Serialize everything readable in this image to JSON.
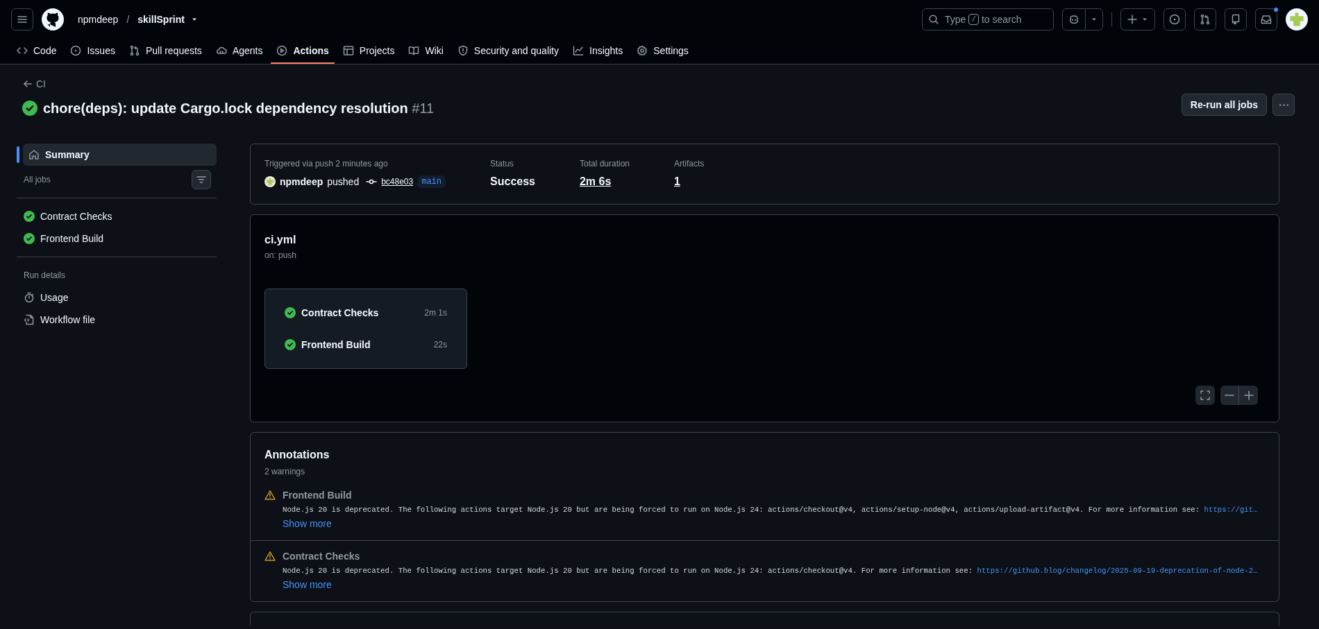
{
  "header": {
    "owner": "npmdeep",
    "separator": "/",
    "repo": "skillSprint",
    "search_placeholder_before": "Type",
    "search_key": "/",
    "search_placeholder_after": "to search",
    "notification_dot": true
  },
  "tabs": [
    {
      "label": "Code",
      "kind": "code",
      "selected": false
    },
    {
      "label": "Issues",
      "kind": "issue",
      "selected": false
    },
    {
      "label": "Pull requests",
      "kind": "pr",
      "selected": false
    },
    {
      "label": "Agents",
      "kind": "agent",
      "selected": false
    },
    {
      "label": "Actions",
      "kind": "play",
      "selected": true
    },
    {
      "label": "Projects",
      "kind": "table",
      "selected": false
    },
    {
      "label": "Wiki",
      "kind": "book",
      "selected": false
    },
    {
      "label": "Security and quality",
      "kind": "shield",
      "selected": false
    },
    {
      "label": "Insights",
      "kind": "graph",
      "selected": false
    },
    {
      "label": "Settings",
      "kind": "gear",
      "selected": false
    }
  ],
  "run": {
    "back_label": "CI",
    "kind": "success",
    "title": "chore(deps): update Cargo.lock dependency resolution",
    "number": "#11",
    "rerun_button": "Re-run all jobs"
  },
  "sidebar": {
    "summary": {
      "label": "Summary",
      "selected": true
    },
    "jobs_heading": "All jobs",
    "jobs": [
      {
        "label": "Contract Checks",
        "kind": "success",
        "selected": false
      },
      {
        "label": "Frontend Build",
        "kind": "success",
        "selected": false
      }
    ],
    "details_heading": "Run details",
    "details": [
      {
        "label": "Usage",
        "kind": "stopwatch"
      },
      {
        "label": "Workflow file",
        "kind": "file"
      }
    ]
  },
  "summary": {
    "trigger": "Triggered via push 2 minutes ago",
    "actor": "npmdeep",
    "action": "pushed",
    "commit": "bc48e03",
    "branch": "main",
    "stats": [
      {
        "label": "Status",
        "value": "Success",
        "link": false
      },
      {
        "label": "Total duration",
        "value": "2m 6s",
        "link": true
      },
      {
        "label": "Artifacts",
        "value": "1",
        "link": true
      }
    ]
  },
  "workflow": {
    "file": "ci.yml",
    "trigger": "on: push",
    "jobs": [
      {
        "name": "Contract Checks",
        "duration": "2m 1s",
        "kind": "success"
      },
      {
        "name": "Frontend Build",
        "duration": "22s",
        "kind": "success"
      }
    ]
  },
  "annotations": {
    "title": "Annotations",
    "count": "2 warnings",
    "items": [
      {
        "kind": "warning",
        "job": "Frontend Build",
        "message": "Node.js 20 is deprecated. The following actions target Node.js 20 but are being forced to run on Node.js 24: actions/checkout@v4, actions/setup-node@v4, actions/upload-artifact@v4. For more information see: ",
        "link": "https://git…",
        "more": "Show more"
      },
      {
        "kind": "warning",
        "job": "Contract Checks",
        "message": "Node.js 20 is deprecated. The following actions target Node.js 20 but are being forced to run on Node.js 24: actions/checkout@v4. For more information see: ",
        "link": "https://github.blog/changelog/2025-09-19-deprecation-of-node-2…",
        "more": "Show more"
      }
    ]
  }
}
